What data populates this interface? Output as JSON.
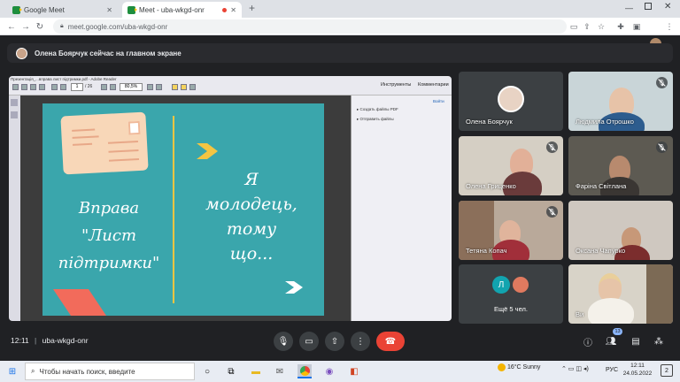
{
  "browser": {
    "tabs": [
      {
        "label": "Google Meet"
      },
      {
        "label": "Meet - uba-wkgd-onr"
      }
    ],
    "new_tab": "+",
    "url": "meet.google.com/uba-wkgd-onr"
  },
  "banner": {
    "text": "Олена Боярчук сейчас на главном экране"
  },
  "presentation": {
    "pdf_title": "Презентація_...вправа лист підтримки.pdf - Adobe Reader",
    "page_current": "1",
    "page_total": "/ 26",
    "zoom": "80,5%",
    "right_tabs": [
      "Инструменты",
      "Комментарии"
    ],
    "right_link": "Войти",
    "right_items": [
      "Создать файлы PDF",
      "Отправить файлы"
    ],
    "slide": {
      "left_lines": [
        "Вправа",
        "\"Лист",
        "підтримки\""
      ],
      "right_lines": [
        "Я",
        "молодець,",
        "тому",
        "що..."
      ]
    }
  },
  "participants": [
    {
      "name": "Олена Боярчук",
      "muted": false
    },
    {
      "name": "Людмила Отрошко",
      "muted": true
    },
    {
      "name": "Олена Гриценко",
      "muted": true
    },
    {
      "name": "Фаріна Світлана",
      "muted": true
    },
    {
      "name": "Тетяна Копач",
      "muted": true
    },
    {
      "name": "Оксана Чапурко",
      "muted": false
    },
    {
      "name": "Ещё 5 чел.",
      "muted": false,
      "initial": "Л"
    },
    {
      "name": "Ви",
      "muted": false
    }
  ],
  "bottom_bar": {
    "time": "12:11",
    "separator": "|",
    "meeting_code": "uba-wkgd-onr",
    "people_count": "13"
  },
  "taskbar": {
    "search_placeholder": "Чтобы начать поиск, введите",
    "weather": "16°C  Sunny",
    "lang": "РУС",
    "time": "12:11",
    "date": "24.05.2022",
    "notifications": "2"
  },
  "colors": {
    "slide_bg": "#3aa6ac",
    "accent_yellow": "#f4c542",
    "hangup": "#ea4335",
    "meet_bg": "#202124"
  }
}
